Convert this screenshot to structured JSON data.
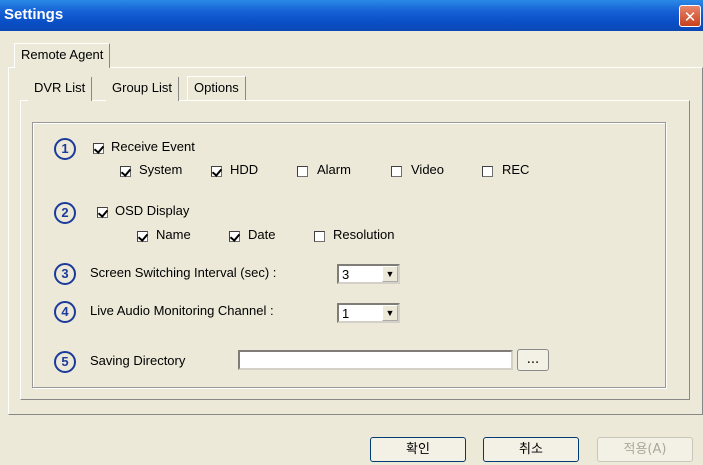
{
  "window": {
    "title": "Settings",
    "close_label": "✕"
  },
  "top_tabs": [
    {
      "label": "Remote Agent"
    }
  ],
  "sub_tabs": [
    {
      "label": "DVR List"
    },
    {
      "label": "Group List"
    },
    {
      "label": "Options"
    }
  ],
  "options": {
    "s1": {
      "num": "1",
      "label": "Receive Event",
      "items": [
        {
          "label": "System"
        },
        {
          "label": "HDD"
        },
        {
          "label": "Alarm"
        },
        {
          "label": "Video"
        },
        {
          "label": "REC"
        }
      ]
    },
    "s2": {
      "num": "2",
      "label": "OSD Display",
      "items": [
        {
          "label": "Name"
        },
        {
          "label": "Date"
        },
        {
          "label": "Resolution"
        }
      ]
    },
    "s3": {
      "num": "3",
      "label": "Screen Switching Interval (sec) :",
      "value": "3"
    },
    "s4": {
      "num": "4",
      "label": "Live Audio Monitoring Channel :",
      "value": "1"
    },
    "s5": {
      "num": "5",
      "label": "Saving Directory",
      "value": "",
      "browse_label": "..."
    }
  },
  "buttons": {
    "ok": "확인",
    "cancel": "취소",
    "apply": "적용(A)"
  },
  "checked": {
    "receive_event": true,
    "system": true,
    "hdd": true,
    "alarm": false,
    "video": false,
    "rec": false,
    "osd_display": true,
    "name": true,
    "date": true,
    "resolution": false
  }
}
